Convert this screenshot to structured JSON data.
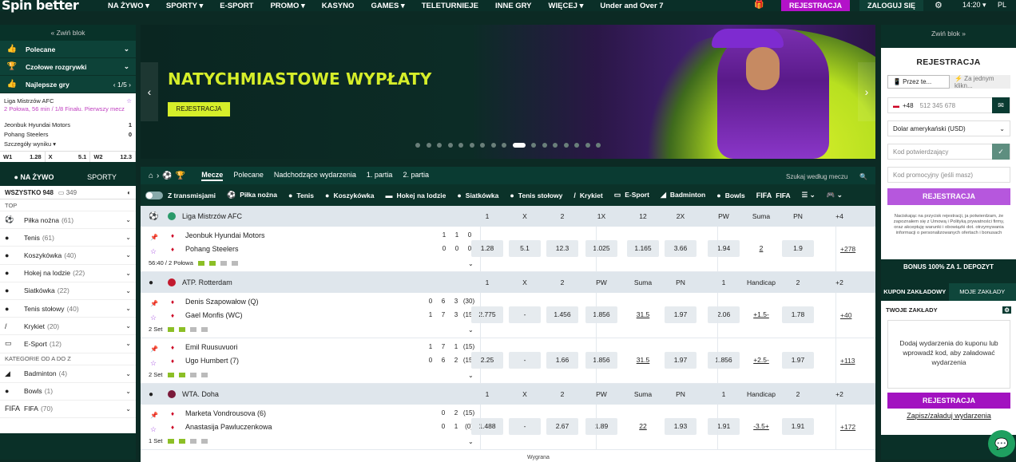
{
  "header": {
    "logo": "Spin better",
    "nav": [
      "NA ŻYWO ▾",
      "SPORTY ▾",
      "E-SPORT",
      "PROMO ▾",
      "KASYNO",
      "GAMES ▾",
      "TELETURNIEJE",
      "INNE GRY",
      "WIĘCEJ ▾"
    ],
    "under_over": "Under and Over 7",
    "register": "REJESTRACJA",
    "login": "ZALOGUJ SIĘ",
    "time": "14:20 ▾",
    "lang": "PL"
  },
  "left": {
    "collapse": "« Zwiń blok",
    "rows": [
      "Polecane",
      "Czołowe rozgrywki",
      "Najlepsze gry"
    ],
    "pager": "‹ 1/5 ›",
    "top_game": {
      "league": "Liga Mistrzów AFC",
      "status": "2 Połowa, 56 min / 1/8 Finału. Pierwszy mecz",
      "team1": "Jeonbuk Hyundai Motors",
      "score1": "1",
      "team2": "Pohang Steelers",
      "score2": "0",
      "details": "Szczegóły wyniku ▾",
      "odds": [
        {
          "k": "W1",
          "v": "1.28"
        },
        {
          "k": "X",
          "v": "5.1"
        },
        {
          "k": "W2",
          "v": "12.3"
        }
      ]
    },
    "tab_live": "● NA ŻYWO",
    "tab_sports": "SPORTY",
    "all_label": "WSZYSTKO 948",
    "all_count": "▭ 349",
    "cat_top": "TOP",
    "sports": [
      {
        "name": "Piłka nożna",
        "count": "(61)",
        "icon": "⚽"
      },
      {
        "name": "Tenis",
        "count": "(61)",
        "icon": "●"
      },
      {
        "name": "Koszykówka",
        "count": "(40)",
        "icon": "●"
      },
      {
        "name": "Hokej na lodzie",
        "count": "(22)",
        "icon": "●"
      },
      {
        "name": "Siatkówka",
        "count": "(22)",
        "icon": "●"
      },
      {
        "name": "Tenis stołowy",
        "count": "(40)",
        "icon": "●"
      },
      {
        "name": "Krykiet",
        "count": "(20)",
        "icon": "/"
      },
      {
        "name": "E-Sport",
        "count": "(12)",
        "icon": "▭"
      }
    ],
    "cat_az": "KATEGORIE OD A DO Z",
    "sports_az": [
      {
        "name": "Badminton",
        "count": "(4)",
        "icon": "◢"
      },
      {
        "name": "Bowls",
        "count": "(1)",
        "icon": "●"
      },
      {
        "name": "FIFA",
        "count": "(70)",
        "icon": "FIFA"
      }
    ]
  },
  "banner": {
    "title": "NATYCHMIASTOWE WYPŁATY",
    "button": "REJESTRACJA",
    "dot_count": 17,
    "active_dot": 9
  },
  "main": {
    "tabs": [
      "Mecze",
      "Polecane",
      "Nadchodzące wydarzenia",
      "1. partia",
      "2. partia"
    ],
    "search_placeholder": "Szukaj według meczu",
    "streams": "Z transmisjami",
    "sports": [
      "Piłka nożna",
      "Tenis",
      "Koszykówka",
      "Hokej na lodzie",
      "Siatkówka",
      "Tenis stołowy",
      "Krykiet",
      "E-Sport",
      "Badminton",
      "Bowls",
      "FIFA"
    ],
    "leagues": [
      {
        "name": "Liga Mistrzów AFC",
        "icon": "⚽",
        "flag_color": "#2a9a6a",
        "cols": [
          "1",
          "X",
          "2",
          "1X",
          "12",
          "2X",
          "PW",
          "Suma",
          "PN",
          "+4"
        ],
        "matches": [
          {
            "team1": "Jeonbuk Hyundai Motors",
            "team2": "Pohang Steelers",
            "s1": [
              "1",
              "1",
              "0"
            ],
            "s2": [
              "0",
              "0",
              "0"
            ],
            "meta": "56:40 / 2 Połowa",
            "odds": [
              "1.28",
              "5.1",
              "12.3",
              "1.025",
              "1.165",
              "3.66",
              "1.94",
              "2",
              "1.9"
            ],
            "more": "+278"
          }
        ]
      },
      {
        "name": "ATP. Rotterdam",
        "icon": "●",
        "flag_color": "#c21a2e",
        "cols": [
          "1",
          "X",
          "2",
          "PW",
          "Suma",
          "PN",
          "1",
          "Handicap",
          "2",
          "+2"
        ],
        "matches": [
          {
            "team1": "Denis Szapowałow (Q)",
            "team2": "Gael Monfis (WC)",
            "s1": [
              "0",
              "6",
              "3",
              "(30)"
            ],
            "s2": [
              "1",
              "7",
              "3",
              "(15)"
            ],
            "meta": "2 Set",
            "odds": [
              "2.775",
              "-",
              "1.456",
              "1.856",
              "31.5",
              "1.97",
              "2.06",
              "+1.5-",
              "1.78"
            ],
            "more": "+40"
          },
          {
            "team1": "Emil Ruusuvuori",
            "team2": "Ugo Humbert (7)",
            "s1": [
              "1",
              "7",
              "1",
              "(15)"
            ],
            "s2": [
              "0",
              "6",
              "2",
              "(15)"
            ],
            "meta": "2 Set",
            "odds": [
              "2.25",
              "-",
              "1.66",
              "1.856",
              "31.5",
              "1.97",
              "1.856",
              "+2.5-",
              "1.97"
            ],
            "more": "+113"
          }
        ]
      },
      {
        "name": "WTA. Doha",
        "icon": "●",
        "flag_color": "#7a1a3a",
        "cols": [
          "1",
          "X",
          "2",
          "PW",
          "Suma",
          "PN",
          "1",
          "Handicap",
          "2",
          "+2"
        ],
        "matches": [
          {
            "team1": "Marketa Vondrousova (6)",
            "team2": "Anastasija Pawluczenkowa",
            "s1": [
              "",
              "0",
              "2",
              "(15)"
            ],
            "s2": [
              "",
              "0",
              "1",
              "(0)"
            ],
            "meta": "1 Set",
            "odds": [
              "1.488",
              "-",
              "2.67",
              "1.89",
              "22",
              "1.93",
              "1.91",
              "-3.5+",
              "1.91"
            ],
            "more": "+172"
          }
        ]
      }
    ],
    "footer_label": "Wygrana"
  },
  "right": {
    "collapse": "Zwiń blok »",
    "title": "REJESTRACJA",
    "tab1": "📱 Przez te...",
    "tab2": "⚡ Za jednym klikn...",
    "phone_code": "+48",
    "phone_placeholder": "512 345 678",
    "currency": "Dolar amerykański (USD)",
    "code_placeholder": "Kod potwierdzający",
    "promo_placeholder": "Kod promocyjny (jeśli masz)",
    "register": "REJESTRACJA",
    "legal": "Naciskając na przycisk rejestracji, ja potwierdzam, że zapoznałem się z Umową i Polityką prywatności firmy, oraz akceptuję warunki i obowiązki dot. otrzymywania informacji o personalizowanych ofertach i bonusach",
    "bonus": "BONUS 100% ZA 1. DEPOZYT",
    "coupon_tab": "KUPON ZAKŁADOWY",
    "my_bets_tab": "MOJE ZAKŁADY",
    "your_bets": "TWOJE ZAKŁADY",
    "empty": "Dodaj wydarzenia do kuponu lub wprowadź kod, aby załadować wydarzenia",
    "coupon_register": "REJESTRACJA",
    "save": "Zapisz/załaduj wydarzenia"
  }
}
